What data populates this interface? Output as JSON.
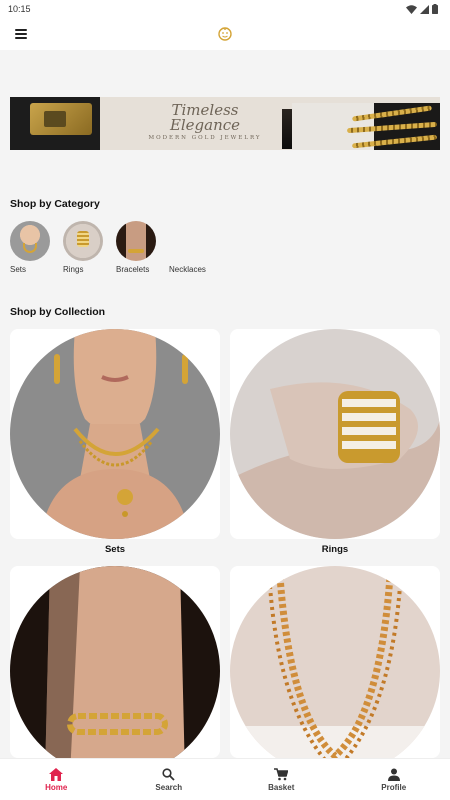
{
  "status_bar": {
    "time": "10:15"
  },
  "banner": {
    "line1": "Timeless",
    "line2": "Elegance",
    "line3": "MODERN GOLD JEWELRY"
  },
  "categories_section": {
    "title": "Shop by Category",
    "items": [
      {
        "label": "Sets"
      },
      {
        "label": "Rings"
      },
      {
        "label": "Bracelets"
      },
      {
        "label": "Necklaces"
      }
    ]
  },
  "collections_section": {
    "title": "Shop by Collection",
    "items": [
      {
        "label": "Sets"
      },
      {
        "label": "Rings"
      },
      {
        "label": ""
      },
      {
        "label": ""
      }
    ]
  },
  "bottom_nav": {
    "items": [
      {
        "label": "Home",
        "icon": "home-icon",
        "active": true
      },
      {
        "label": "Search",
        "icon": "search-icon",
        "active": false
      },
      {
        "label": "Basket",
        "icon": "cart-icon",
        "active": false
      },
      {
        "label": "Profile",
        "icon": "person-icon",
        "active": false
      }
    ]
  },
  "colors": {
    "accent": "#e0224d",
    "gold": "#d4a437",
    "background": "#f4f4f4"
  }
}
